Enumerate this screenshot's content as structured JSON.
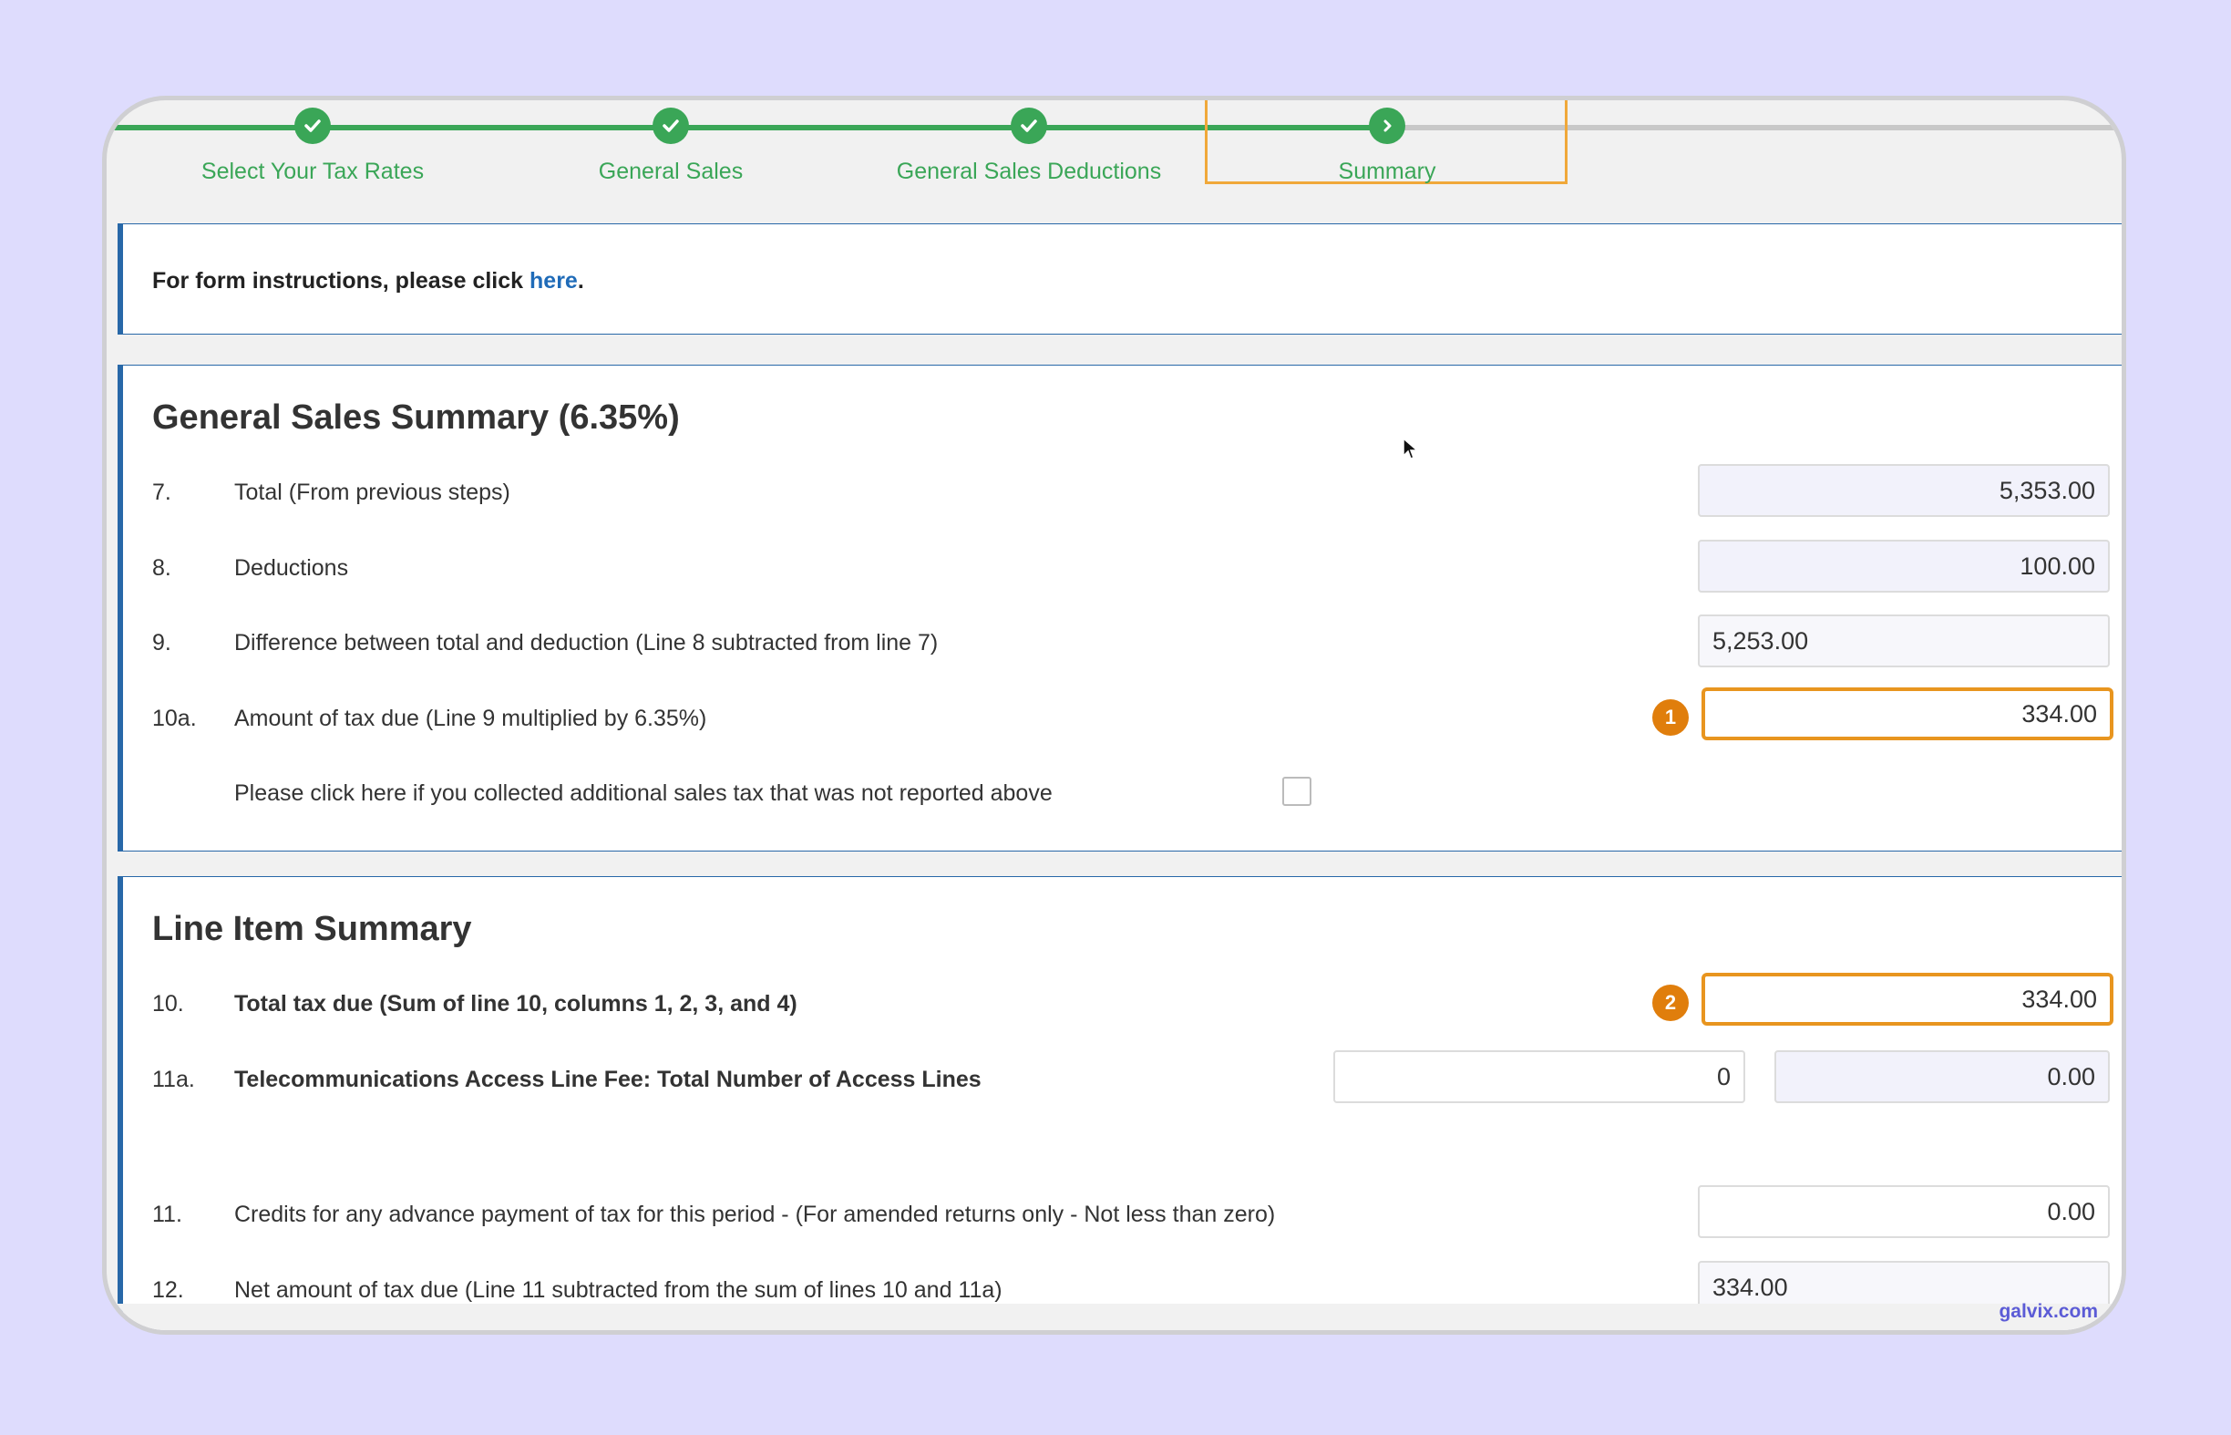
{
  "stepper": {
    "steps": [
      {
        "label": "Select Your Tax Rates",
        "state": "done",
        "icon": "check-icon"
      },
      {
        "label": "General Sales",
        "state": "done",
        "icon": "check-icon"
      },
      {
        "label": "General Sales Deductions",
        "state": "done",
        "icon": "check-icon"
      },
      {
        "label": "Summary",
        "state": "current",
        "icon": "chevron-right-icon"
      }
    ]
  },
  "instructions": {
    "prefix": "For form instructions, please click ",
    "link": "here",
    "suffix": "."
  },
  "general_sales_summary": {
    "title": "General Sales Summary (6.35%)",
    "rows": [
      {
        "num": "7.",
        "label": "Total (From previous steps)",
        "value": "5,353.00"
      },
      {
        "num": "8.",
        "label": "Deductions",
        "value": "100.00"
      },
      {
        "num": "9.",
        "label": "Difference between total and deduction (Line 8 subtracted from line 7)",
        "value": "5,253.00"
      },
      {
        "num": "10a.",
        "label": "Amount of tax due (Line 9 multiplied by 6.35%)",
        "value": "334.00",
        "badge": "1"
      }
    ],
    "additional_tax_label": "Please click here if you collected additional sales tax that was not reported above"
  },
  "line_item_summary": {
    "title": "Line Item Summary",
    "rows": [
      {
        "num": "10.",
        "label": "Total tax due (Sum of line 10, columns 1, 2, 3, and 4)",
        "value": "334.00",
        "badge": "2"
      },
      {
        "num": "11a.",
        "label": "Telecommunications Access Line Fee: Total Number of Access Lines",
        "count": "0",
        "value": "0.00"
      },
      {
        "num": "11.",
        "label": "Credits for any advance payment of tax for this period - (For amended returns only - Not less than zero)",
        "value": "0.00"
      },
      {
        "num": "12.",
        "label": "Net amount of tax due (Line 11 subtracted from the sum of lines 10 and 11a)",
        "value": "334.00"
      }
    ]
  },
  "watermark": "galvix.com",
  "colors": {
    "accent": "#3aa657",
    "highlight": "#e8951f",
    "badge": "#e07e0c",
    "panel_border": "#2868a8"
  }
}
